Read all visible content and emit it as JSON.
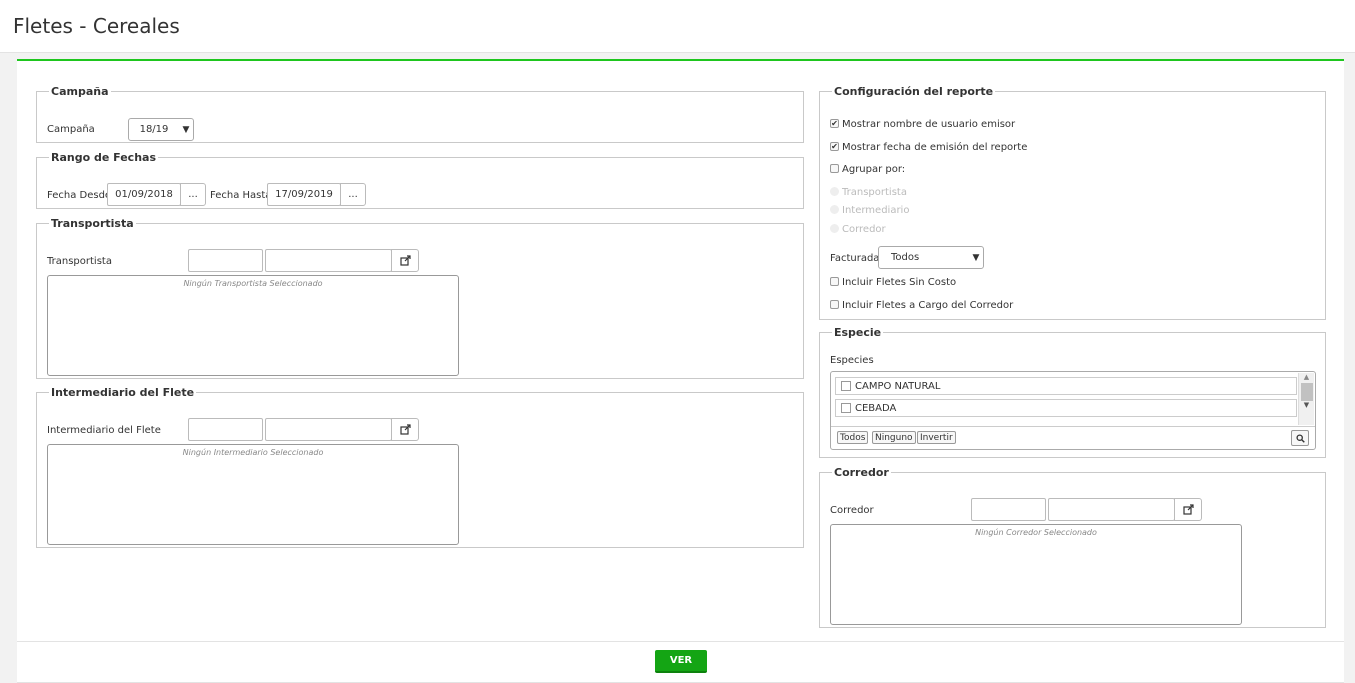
{
  "header": {
    "title": "Fletes - Cereales"
  },
  "campania": {
    "legend": "Campaña",
    "label": "Campaña",
    "selected": "18/19"
  },
  "rango": {
    "legend": "Rango de Fechas",
    "desde_label": "Fecha Desde",
    "desde_value": "01/09/2018",
    "hasta_label": "Fecha Hasta",
    "hasta_value": "17/09/2019",
    "dots": "..."
  },
  "transportista": {
    "legend": "Transportista",
    "label": "Transportista",
    "empty": "Ningún Transportista Seleccionado"
  },
  "intermediario": {
    "legend": "Intermediario del Flete",
    "label": "Intermediario del Flete",
    "empty": "Ningún Intermediario Seleccionado"
  },
  "config": {
    "legend": "Configuración del reporte",
    "mostrar_usuario": "Mostrar nombre de usuario emisor",
    "mostrar_fecha": "Mostrar fecha de emisión del reporte",
    "agrupar": "Agrupar por:",
    "opt_transportista": "Transportista",
    "opt_intermediario": "Intermediario",
    "opt_corredor": "Corredor",
    "facturada_label": "Facturada",
    "facturada_value": "Todos",
    "sin_costo": "Incluir Fletes Sin Costo",
    "cargo_corredor": "Incluir Fletes a Cargo del Corredor"
  },
  "especie": {
    "legend": "Especie",
    "label": "Especies",
    "items": [
      "CAMPO NATURAL",
      "CEBADA"
    ],
    "todos": "Todos",
    "ninguno": "Ninguno",
    "invertir": "Invertir"
  },
  "corredor": {
    "legend": "Corredor",
    "label": "Corredor",
    "empty": "Ningún Corredor Seleccionado"
  },
  "footer": {
    "ver": "VER"
  },
  "colors": {
    "accent": "#1ec61e",
    "button": "#14a514"
  }
}
